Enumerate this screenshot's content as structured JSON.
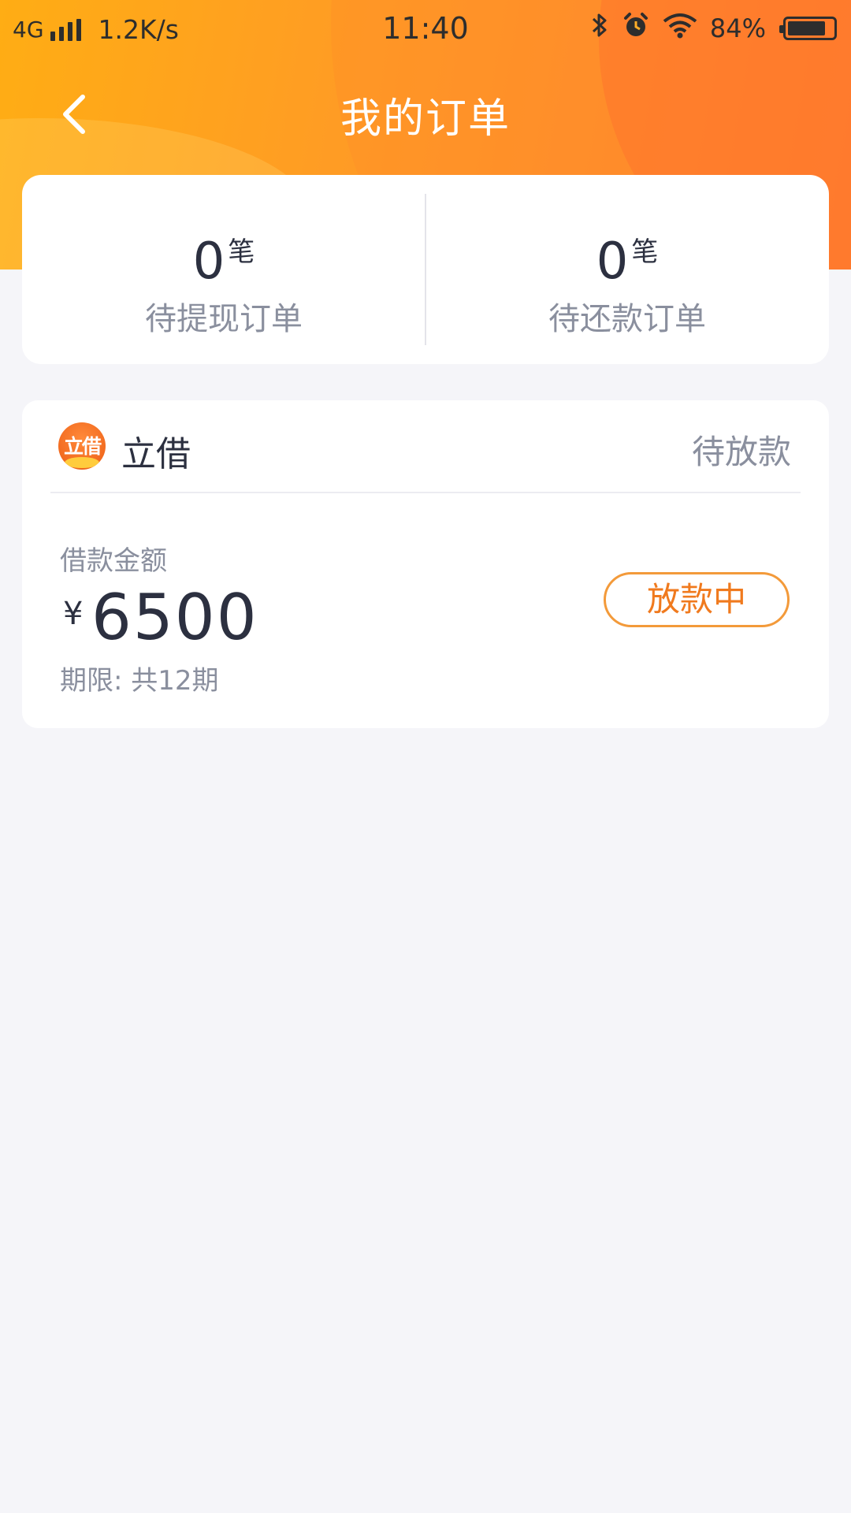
{
  "status_bar": {
    "network": "4G",
    "speed": "1.2K/s",
    "time": "11:40",
    "battery_percent_text": "84%",
    "battery_level": 0.84,
    "icons": [
      "signal-icon",
      "bluetooth-icon",
      "alarm-icon",
      "wifi-icon",
      "battery-icon"
    ]
  },
  "nav": {
    "title": "我的订单",
    "back_icon": "chevron-left-icon"
  },
  "summary": {
    "pending_withdraw": {
      "count": "0",
      "unit": "笔",
      "label": "待提现订单"
    },
    "pending_repay": {
      "count": "0",
      "unit": "笔",
      "label": "待还款订单"
    }
  },
  "order": {
    "lender_logo_text": "立借",
    "lender_name": "立借",
    "status": "待放款",
    "amount_label": "借款金额",
    "currency": "¥",
    "amount": "6500",
    "term": "期限: 共12期",
    "action_label": "放款中"
  },
  "colors": {
    "header_gradient_start": "#ffad14",
    "header_gradient_end": "#ff7f33",
    "accent": "#f07a1e",
    "background": "#f5f5f9"
  }
}
